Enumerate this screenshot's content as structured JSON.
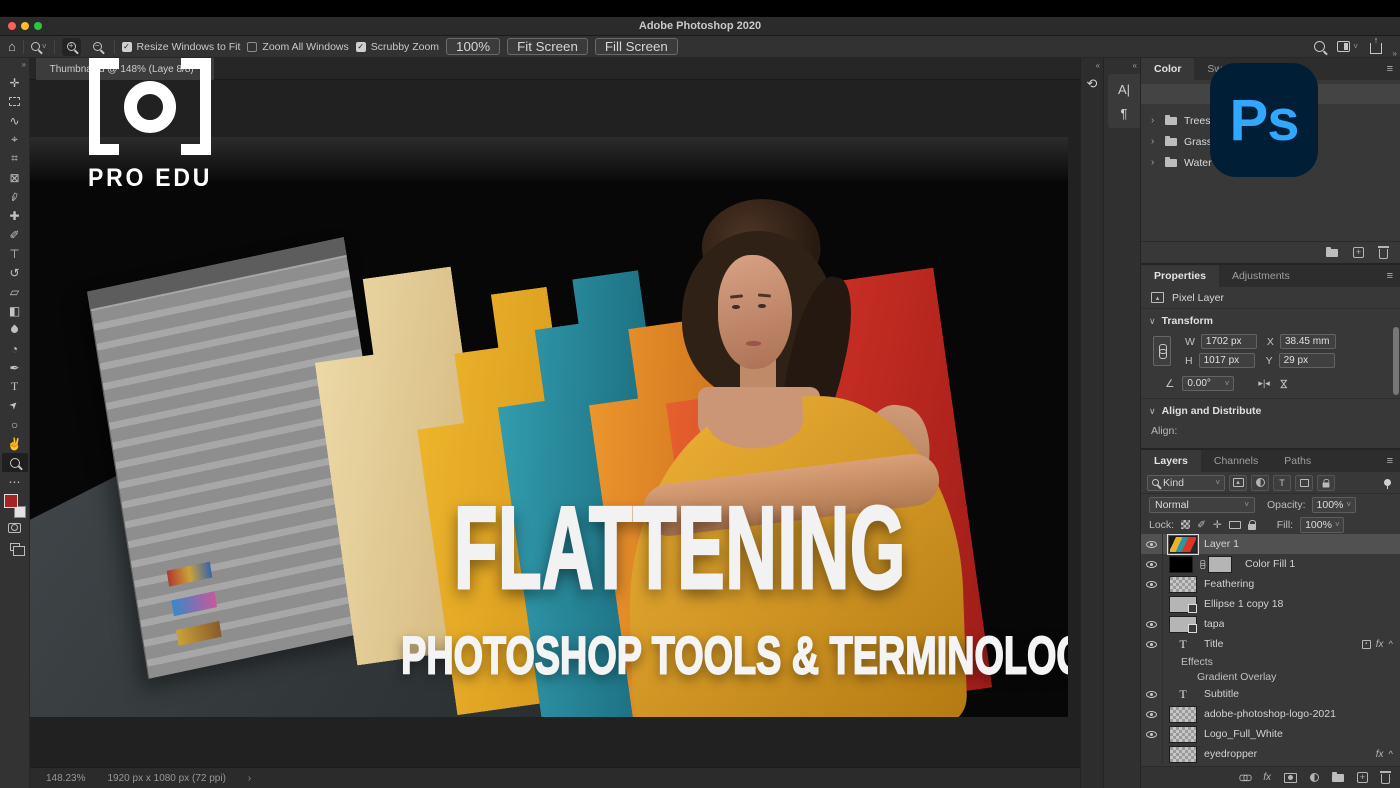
{
  "window": {
    "title": "Adobe Photoshop 2020"
  },
  "options_bar": {
    "resize_windows_label": "Resize Windows to Fit",
    "zoom_all_label": "Zoom All Windows",
    "scrubby_label": "Scrubby Zoom",
    "zoom_100_label": "100%",
    "fit_screen_label": "Fit Screen",
    "fill_screen_label": "Fill Screen"
  },
  "document_tab": {
    "label": "Thumbnail d @ 148% (Laye 8/8) *"
  },
  "side_strips": {
    "character_icon": "A|",
    "paragraph_icon": "¶",
    "history_icon": "⟲"
  },
  "color_swatches_panel": {
    "tab_color": "Color",
    "tab_swatches": "Swatches",
    "groups": [
      {
        "name": "Trees"
      },
      {
        "name": "Grass"
      },
      {
        "name": "Water"
      }
    ]
  },
  "properties_panel": {
    "tab_properties": "Properties",
    "tab_adjustments": "Adjustments",
    "layer_type": "Pixel Layer",
    "transform_title": "Transform",
    "w_label": "W",
    "w_value": "1702 px",
    "x_label": "X",
    "x_value": "38.45 mm",
    "h_label": "H",
    "h_value": "1017 px",
    "y_label": "Y",
    "y_value": "29 px",
    "angle_value": "0.00°",
    "align_title": "Align and Distribute",
    "align_label": "Align:"
  },
  "layers_panel": {
    "tab_layers": "Layers",
    "tab_channels": "Channels",
    "tab_paths": "Paths",
    "kind_label": "Kind",
    "blend_mode": "Normal",
    "opacity_label": "Opacity:",
    "opacity_value": "100%",
    "lock_label": "Lock:",
    "fill_label": "Fill:",
    "fill_value": "100%",
    "fx_label": "fx",
    "rows": [
      {
        "name": "Layer 1",
        "selected": true,
        "visible": true
      },
      {
        "name": "Color Fill 1",
        "visible": true
      },
      {
        "name": "Feathering",
        "visible": true
      },
      {
        "name": "Ellipse 1 copy 18",
        "visible": false
      },
      {
        "name": "tapa",
        "visible": true
      },
      {
        "name": "Title",
        "visible": true,
        "has_fx": true
      },
      {
        "name": "Effects"
      },
      {
        "name": "Gradient Overlay"
      },
      {
        "name": "Subtitle",
        "visible": true
      },
      {
        "name": "adobe-photoshop-logo-2021",
        "visible": true
      },
      {
        "name": "Logo_Full_White",
        "visible": true
      },
      {
        "name": "eyedropper",
        "visible": false,
        "has_fx": true
      }
    ]
  },
  "status_bar": {
    "zoom_level": "148.23%",
    "document_size": "1920 px x 1080 px (72 ppi)",
    "chevron": "›"
  },
  "canvas_art": {
    "title": "FLATTENING",
    "subtitle": "PHOTOSHOP TOOLS & TERMINOLOGY",
    "brand": "PRO EDU"
  },
  "ps_badge": {
    "text": "Ps"
  },
  "colors": {
    "ps_badge_bg": "#001e36",
    "ps_badge_text": "#31a8ff",
    "foreground_swatch": "#a62323",
    "traffic_red": "#ff5f57",
    "traffic_yellow": "#febc2e",
    "traffic_green": "#28c840"
  },
  "icons": {
    "home": "⌂",
    "chevron": "˅",
    "menu": "≡",
    "collapse": "«",
    "expand": "»",
    "tree_chevron": "›",
    "section": "∨",
    "caret": "^",
    "move": "✛",
    "lasso": "∿",
    "object_selection": "⌖",
    "crop": "⌗",
    "frame": "⊠",
    "healing": "✚",
    "brush": "✐",
    "stamp": "⊤",
    "history": "↺",
    "eraser": "▱",
    "gradient": "◧",
    "dodge": "◔",
    "pen": "✒",
    "type": "T",
    "path_select": "➤",
    "shape": "○",
    "hand": "✌",
    "more": "⋯",
    "eyedropper": "✑",
    "pixel_mark": "▴",
    "flip_h": "▸|◂",
    "bowtie": "⋈",
    "angle": "∠"
  }
}
